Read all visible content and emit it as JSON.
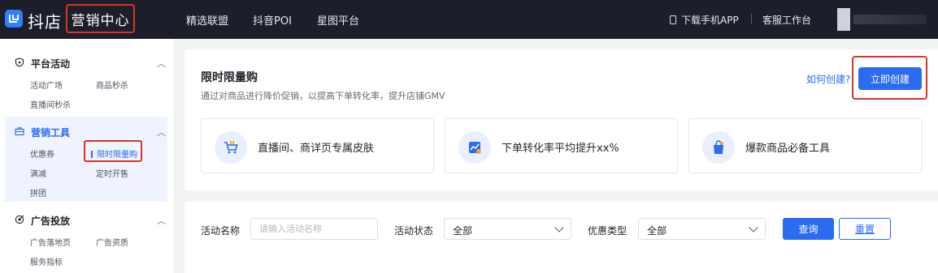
{
  "header": {
    "brand": "抖店",
    "center": "营销中心",
    "nav": [
      "精选联盟",
      "抖音POI",
      "星图平台"
    ],
    "download": "下载手机APP",
    "service": "客服工作台"
  },
  "sidebar": {
    "groups": [
      {
        "title": "平台活动",
        "icon": "shield-icon",
        "items": [
          "活动广场",
          "商品秒杀",
          "直播间秒杀"
        ]
      },
      {
        "title": "营销工具",
        "icon": "toolbox-icon",
        "items": [
          "优惠券",
          "限时限量购",
          "满减",
          "定时开售",
          "拼团"
        ]
      },
      {
        "title": "广告投放",
        "icon": "target-icon",
        "items": [
          "广告落地页",
          "广告资质",
          "服务指标"
        ]
      }
    ]
  },
  "hero": {
    "title": "限时限量购",
    "subtitle": "通过对商品进行降价促销，以提高下单转化率，提升店铺GMV",
    "how_link": "如何创建?",
    "create_button": "立即创建",
    "features": [
      {
        "icon": "cart-icon",
        "label": "直播间、商详页专属皮肤"
      },
      {
        "icon": "chart-icon",
        "label": "下单转化率平均提升xx%"
      },
      {
        "icon": "bag-icon",
        "label": "爆款商品必备工具"
      }
    ]
  },
  "filter": {
    "name_label": "活动名称",
    "name_placeholder": "请输入活动名称",
    "status_label": "活动状态",
    "status_value": "全部",
    "type_label": "优惠类型",
    "type_value": "全部",
    "query_button": "查询",
    "reset_button": "重置"
  },
  "colors": {
    "accent": "#2a6bf2",
    "highlight": "#d9342b",
    "topbar": "#1c1f2a"
  }
}
